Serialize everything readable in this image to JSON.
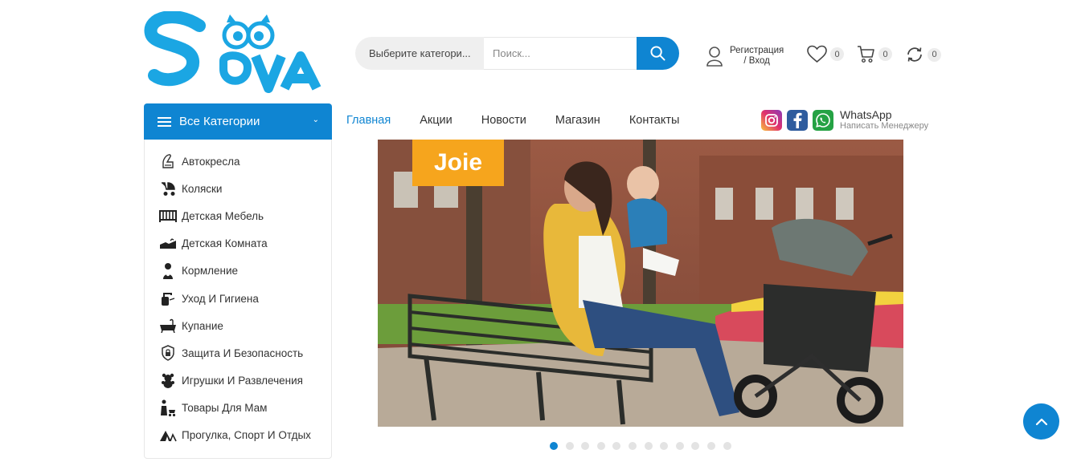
{
  "brand": {
    "name": "SOVA"
  },
  "search": {
    "category_label": "Выберите категори...",
    "placeholder": "Поиск...",
    "value": ""
  },
  "account": {
    "line1": "Регистрация",
    "line2": "/ Вход"
  },
  "wishlist": {
    "count": "0"
  },
  "cart": {
    "count": "0"
  },
  "compare": {
    "count": "0"
  },
  "categories": {
    "title": "Все Категории",
    "items": [
      {
        "label": "Автокресла",
        "icon": "car-seat-icon"
      },
      {
        "label": "Коляски",
        "icon": "stroller-icon"
      },
      {
        "label": "Детская Мебель",
        "icon": "crib-icon"
      },
      {
        "label": "Детская Комната",
        "icon": "nursery-icon"
      },
      {
        "label": "Кормление",
        "icon": "baby-bottle-icon"
      },
      {
        "label": "Уход И Гигиена",
        "icon": "hygiene-icon"
      },
      {
        "label": "Купание",
        "icon": "bathtub-icon"
      },
      {
        "label": "Защита И Безопасность",
        "icon": "shield-lock-icon"
      },
      {
        "label": "Игрушки И Развлечения",
        "icon": "teddy-bear-icon"
      },
      {
        "label": "Товары Для Мам",
        "icon": "mother-icon"
      },
      {
        "label": "Прогулка, Спорт И Отдых",
        "icon": "tent-icon"
      }
    ]
  },
  "nav": {
    "items": [
      {
        "label": "Главная",
        "active": true
      },
      {
        "label": "Акции"
      },
      {
        "label": "Новости"
      },
      {
        "label": "Магазин"
      },
      {
        "label": "Контакты"
      }
    ]
  },
  "social": {
    "whatsapp_title": "WhatsApp",
    "whatsapp_sub": "Написать Менеджеру"
  },
  "banner": {
    "brand_label": "Joie"
  },
  "slider": {
    "total": 12,
    "active": 1
  },
  "colors": {
    "accent": "#0f85d2",
    "logo": "#1ba6e3"
  }
}
